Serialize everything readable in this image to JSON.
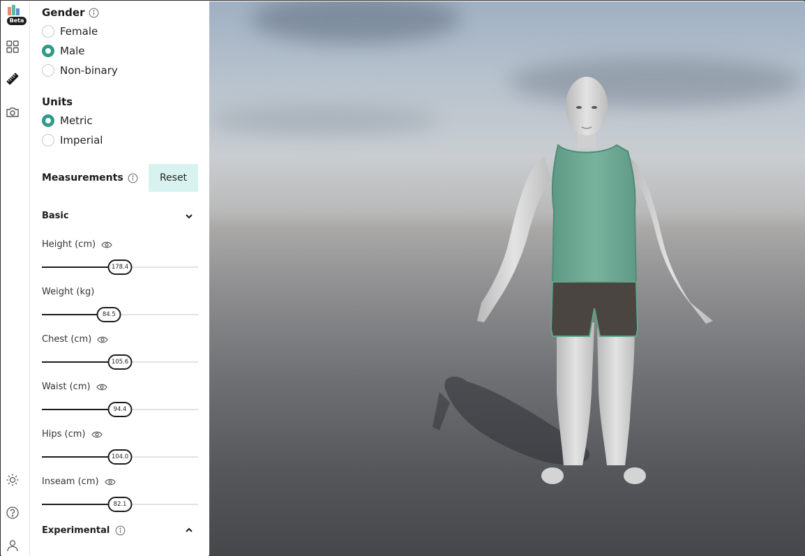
{
  "app": {
    "badge": "Beta"
  },
  "rail": {
    "items": [
      "dashboard-icon",
      "ruler-icon",
      "camera-icon",
      "sun-icon",
      "help-icon",
      "user-icon"
    ]
  },
  "gender": {
    "title": "Gender",
    "options": [
      {
        "label": "Female",
        "selected": false
      },
      {
        "label": "Male",
        "selected": true
      },
      {
        "label": "Non-binary",
        "selected": false
      }
    ]
  },
  "units": {
    "title": "Units",
    "options": [
      {
        "label": "Metric",
        "selected": true
      },
      {
        "label": "Imperial",
        "selected": false
      }
    ]
  },
  "measurements": {
    "title": "Measurements",
    "reset_label": "Reset",
    "basic_label": "Basic",
    "experimental_label": "Experimental",
    "items": [
      {
        "label": "Height (cm)",
        "value": "178.4",
        "fraction": 0.5,
        "visible_toggle": true
      },
      {
        "label": "Weight (kg)",
        "value": "84.5",
        "fraction": 0.43,
        "visible_toggle": false
      },
      {
        "label": "Chest (cm)",
        "value": "105.6",
        "fraction": 0.5,
        "visible_toggle": true
      },
      {
        "label": "Waist (cm)",
        "value": "94.4",
        "fraction": 0.5,
        "visible_toggle": true
      },
      {
        "label": "Hips (cm)",
        "value": "104.0",
        "fraction": 0.5,
        "visible_toggle": true
      },
      {
        "label": "Inseam (cm)",
        "value": "82.1",
        "fraction": 0.5,
        "visible_toggle": true
      }
    ]
  },
  "colors": {
    "accent": "#2f9b88",
    "reset_bg": "#d8f3ef",
    "shirt": "#6aa892",
    "shorts": "#4a4540",
    "skin": "#d6d6d6"
  }
}
